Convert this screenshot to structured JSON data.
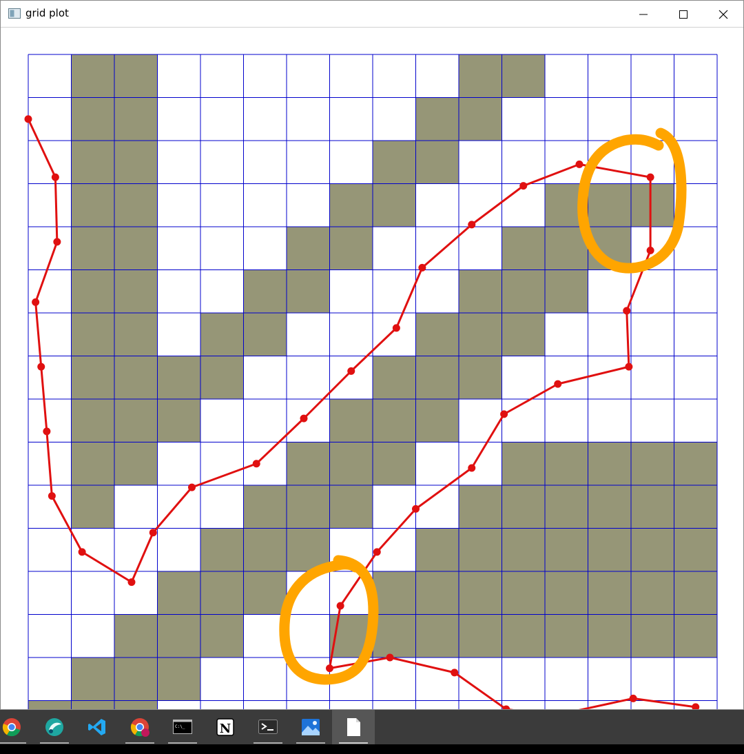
{
  "window": {
    "title": "grid plot",
    "controls": [
      "minimize",
      "maximize",
      "close"
    ]
  },
  "grid": {
    "rows": 16,
    "cols": 16,
    "line_color": "#0000cc",
    "obstacle_color": "#969677",
    "free_color": "#ffffff",
    "obstacles": [
      [
        1,
        2,
        10,
        11
      ],
      [
        1,
        2,
        9,
        10
      ],
      [
        1,
        2,
        8,
        9
      ],
      [
        1,
        2,
        7,
        8,
        12,
        13,
        14
      ],
      [
        1,
        2,
        6,
        7,
        11,
        12,
        13
      ],
      [
        1,
        2,
        5,
        6,
        10,
        11,
        12
      ],
      [
        1,
        2,
        4,
        5,
        9,
        10,
        11
      ],
      [
        1,
        2,
        3,
        4,
        8,
        9,
        10
      ],
      [
        1,
        2,
        3,
        7,
        8,
        9
      ],
      [
        1,
        2,
        6,
        7,
        8,
        11,
        12,
        13,
        14,
        15
      ],
      [
        1,
        5,
        6,
        7,
        10,
        11,
        12,
        13,
        14,
        15
      ],
      [
        4,
        5,
        6,
        9,
        10,
        11,
        12,
        13,
        14,
        15
      ],
      [
        3,
        4,
        5,
        8,
        9,
        10,
        11,
        12,
        13,
        14,
        15
      ],
      [
        2,
        3,
        4,
        7,
        8,
        9,
        10,
        11,
        12,
        13,
        14,
        15
      ],
      [
        1,
        2,
        3
      ],
      [
        0,
        1,
        2
      ]
    ]
  },
  "path": {
    "color": "#e01010",
    "points": [
      [
        0,
        1.5
      ],
      [
        0.63,
        2.85
      ],
      [
        0.67,
        4.35
      ],
      [
        0.17,
        5.75
      ],
      [
        0.3,
        7.25
      ],
      [
        0.43,
        8.75
      ],
      [
        0.55,
        10.25
      ],
      [
        1.25,
        11.55
      ],
      [
        2.4,
        12.25
      ],
      [
        2.9,
        11.1
      ],
      [
        3.8,
        10.05
      ],
      [
        5.3,
        9.5
      ],
      [
        6.4,
        8.45
      ],
      [
        7.5,
        7.35
      ],
      [
        8.55,
        6.35
      ],
      [
        9.15,
        4.95
      ],
      [
        10.3,
        3.95
      ],
      [
        11.5,
        3.05
      ],
      [
        12.8,
        2.55
      ],
      [
        14.45,
        2.85
      ],
      [
        14.45,
        4.55
      ],
      [
        13.9,
        5.95
      ],
      [
        13.95,
        7.25
      ],
      [
        12.3,
        7.65
      ],
      [
        11.05,
        8.35
      ],
      [
        10.3,
        9.6
      ],
      [
        9.0,
        10.55
      ],
      [
        8.1,
        11.55
      ],
      [
        7.25,
        12.8
      ],
      [
        7.0,
        14.25
      ],
      [
        8.4,
        14.0
      ],
      [
        9.9,
        14.35
      ],
      [
        11.1,
        15.2
      ],
      [
        12.2,
        15.35
      ],
      [
        14.05,
        14.95
      ],
      [
        15.5,
        15.15
      ]
    ]
  },
  "annotations": {
    "color": "#ffa500",
    "circles": [
      "upper-right",
      "lower-middle"
    ]
  },
  "taskbar": {
    "apps": [
      "chrome",
      "app-circle",
      "vscode",
      "chrome-profile",
      "command-prompt",
      "notion",
      "terminal",
      "photos",
      "file"
    ],
    "notion_glyph": "N",
    "cmd_glyph": "C:\\_",
    "colors": {
      "bg": "#3b3b3b",
      "active": "#565656"
    }
  }
}
